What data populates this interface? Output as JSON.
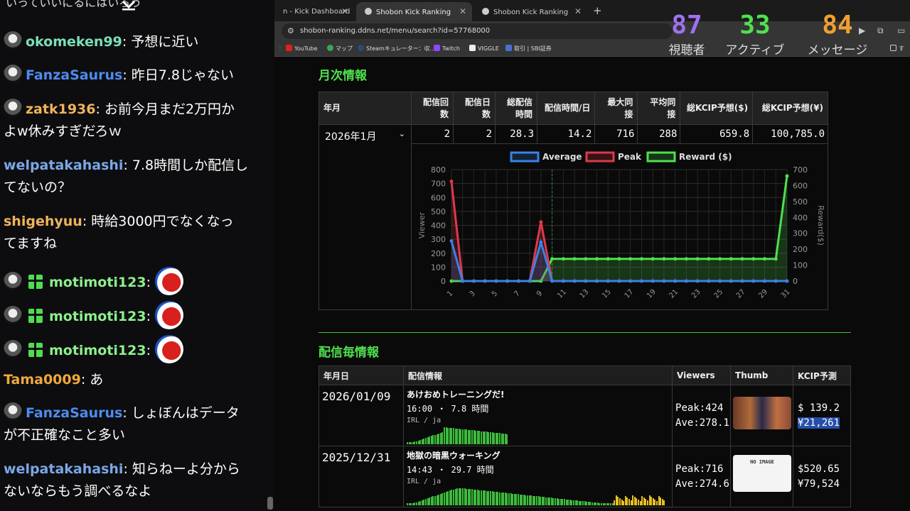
{
  "chat": {
    "top_fragment": "いっていいにるにはいろう",
    "messages": [
      {
        "user": "okomeken99",
        "color": "#7be0b6",
        "text": "予想に近い",
        "avatar": true
      },
      {
        "user": "FanzaSaurus",
        "color": "#4d8cf0",
        "text": "昨日7.8じゃない",
        "avatar": true
      },
      {
        "user": "zatk1936",
        "color": "#f0b45a",
        "text": "お前今月まだ2万円か",
        "text2": "よw休みすぎだろｗ",
        "avatar": true
      },
      {
        "user": "welpatakahashi",
        "color": "#7aa7e6",
        "text": "7.8時間しか配信し",
        "text2": "てないの？",
        "avatar": false
      },
      {
        "user": "shigehyuu",
        "color": "#f0b45a",
        "text": "時給3000円でなくなっ",
        "text2": "てますね",
        "avatar": false
      },
      {
        "user": "motimoti123",
        "color": "#8cf08c",
        "text": "",
        "avatar": true,
        "gift": true,
        "emote": true
      },
      {
        "user": "motimoti123",
        "color": "#8cf08c",
        "text": "",
        "avatar": true,
        "gift": true,
        "emote": true
      },
      {
        "user": "motimoti123",
        "color": "#8cf08c",
        "text": "",
        "avatar": true,
        "gift": true,
        "emote": true
      },
      {
        "user": "Tama0009",
        "color": "#f0a83c",
        "text": "あ",
        "avatar": false
      },
      {
        "user": "FanzaSaurus",
        "color": "#4d8cf0",
        "text": "しょぼんはデータ",
        "text2": "が不正確なこと多い",
        "avatar": true
      },
      {
        "user": "welpatakahashi",
        "color": "#7aa7e6",
        "text": "知らねーよ分から",
        "text2": "ないならもう調べるなよ",
        "avatar": false
      }
    ]
  },
  "browser": {
    "tabs": [
      {
        "label": "n - Kick Dashboard"
      },
      {
        "label": "Shobon Kick Ranking"
      },
      {
        "label": "Shobon Kick Ranking"
      }
    ],
    "url": "shobon-ranking.ddns.net/menu/search?id=57768000",
    "bookmarks": [
      "YouTube",
      "マップ",
      "Steamキュレーター：収...",
      "Twitch",
      "VIGGLE",
      "取引 | SBI証券"
    ],
    "bookmarks_folder": "す"
  },
  "overlay": [
    {
      "value": "87",
      "label": "視聴者",
      "color": "#a070f0"
    },
    {
      "value": "33",
      "label": "アクティブ",
      "color": "#50e050"
    },
    {
      "value": "84",
      "label": "メッセージ",
      "color": "#f0a030"
    }
  ],
  "monthly": {
    "heading": "月次情報",
    "headers": [
      "年月",
      "配信回数",
      "配信日数",
      "総配信時間",
      "配信時間/日",
      "最大同接",
      "平均同接",
      "総KCIP予想($)",
      "総KCIP予想(¥)"
    ],
    "month_select": "2026年1月",
    "row": [
      "2",
      "2",
      "28.3",
      "14.2",
      "716",
      "288",
      "659.8",
      "100,785.0"
    ]
  },
  "chart_data": {
    "type": "line",
    "x": [
      1,
      2,
      3,
      4,
      5,
      6,
      7,
      8,
      9,
      10,
      11,
      12,
      13,
      14,
      15,
      16,
      17,
      18,
      19,
      20,
      21,
      22,
      23,
      24,
      25,
      26,
      27,
      28,
      29,
      30,
      31
    ],
    "x_ticks": [
      "1",
      "3",
      "5",
      "7",
      "9",
      "11",
      "13",
      "15",
      "17",
      "19",
      "21",
      "23",
      "25",
      "27",
      "29",
      "31"
    ],
    "series": [
      {
        "name": "Average",
        "color": "#3b82e6",
        "axis": "left",
        "values": [
          288,
          0,
          0,
          0,
          0,
          0,
          0,
          0,
          278,
          0,
          0,
          0,
          0,
          0,
          0,
          0,
          0,
          0,
          0,
          0,
          0,
          0,
          0,
          0,
          0,
          0,
          0,
          0,
          0,
          0,
          0
        ]
      },
      {
        "name": "Peak",
        "color": "#e0384c",
        "axis": "left",
        "values": [
          716,
          0,
          0,
          0,
          0,
          0,
          0,
          0,
          424,
          0,
          0,
          0,
          0,
          0,
          0,
          0,
          0,
          0,
          0,
          0,
          0,
          0,
          0,
          0,
          0,
          0,
          0,
          0,
          0,
          0,
          0
        ]
      },
      {
        "name": "Reward ($)",
        "color": "#4fe04f",
        "axis": "right",
        "values": [
          0,
          0,
          0,
          0,
          0,
          0,
          0,
          0,
          0,
          139.2,
          139.2,
          139.2,
          139.2,
          139.2,
          139.2,
          139.2,
          139.2,
          139.2,
          139.2,
          139.2,
          139.2,
          139.2,
          139.2,
          139.2,
          139.2,
          139.2,
          139.2,
          139.2,
          139.2,
          139.2,
          659.8
        ]
      }
    ],
    "ylabel": "Viewer",
    "y2label": "Reward($)",
    "ylim": [
      0,
      800
    ],
    "y2lim": [
      0,
      700
    ],
    "y_ticks": [
      "0",
      "100",
      "200",
      "300",
      "400",
      "500",
      "600",
      "700",
      "800"
    ],
    "y2_ticks": [
      "0",
      "100",
      "200",
      "300",
      "400",
      "500",
      "600",
      "700"
    ],
    "grid": true,
    "legend": "top"
  },
  "streams": {
    "heading": "配信毎情報",
    "headers": [
      "年月日",
      "配信情報",
      "Viewers",
      "Thumb",
      "KCIP予測"
    ],
    "rows": [
      {
        "date": "2026/01/09",
        "title": "あけおめトレーニングだ!",
        "time": "16:00 ・ 7.8 時間",
        "meta": "IRL / ja",
        "peak": "Peak:424",
        "ave": "Ave:278.1",
        "usd": "$ 139.2",
        "jpy": "¥21,261"
      },
      {
        "date": "2025/12/31",
        "title": "地獄の暗黒ウォーキング",
        "time": "14:43 ・ 29.7 時間",
        "meta": "IRL / ja",
        "peak": "Peak:716",
        "ave": "Ave:274.6",
        "usd": "$520.65",
        "jpy": "¥79,524",
        "no_image": "NO IMAGE"
      }
    ]
  }
}
